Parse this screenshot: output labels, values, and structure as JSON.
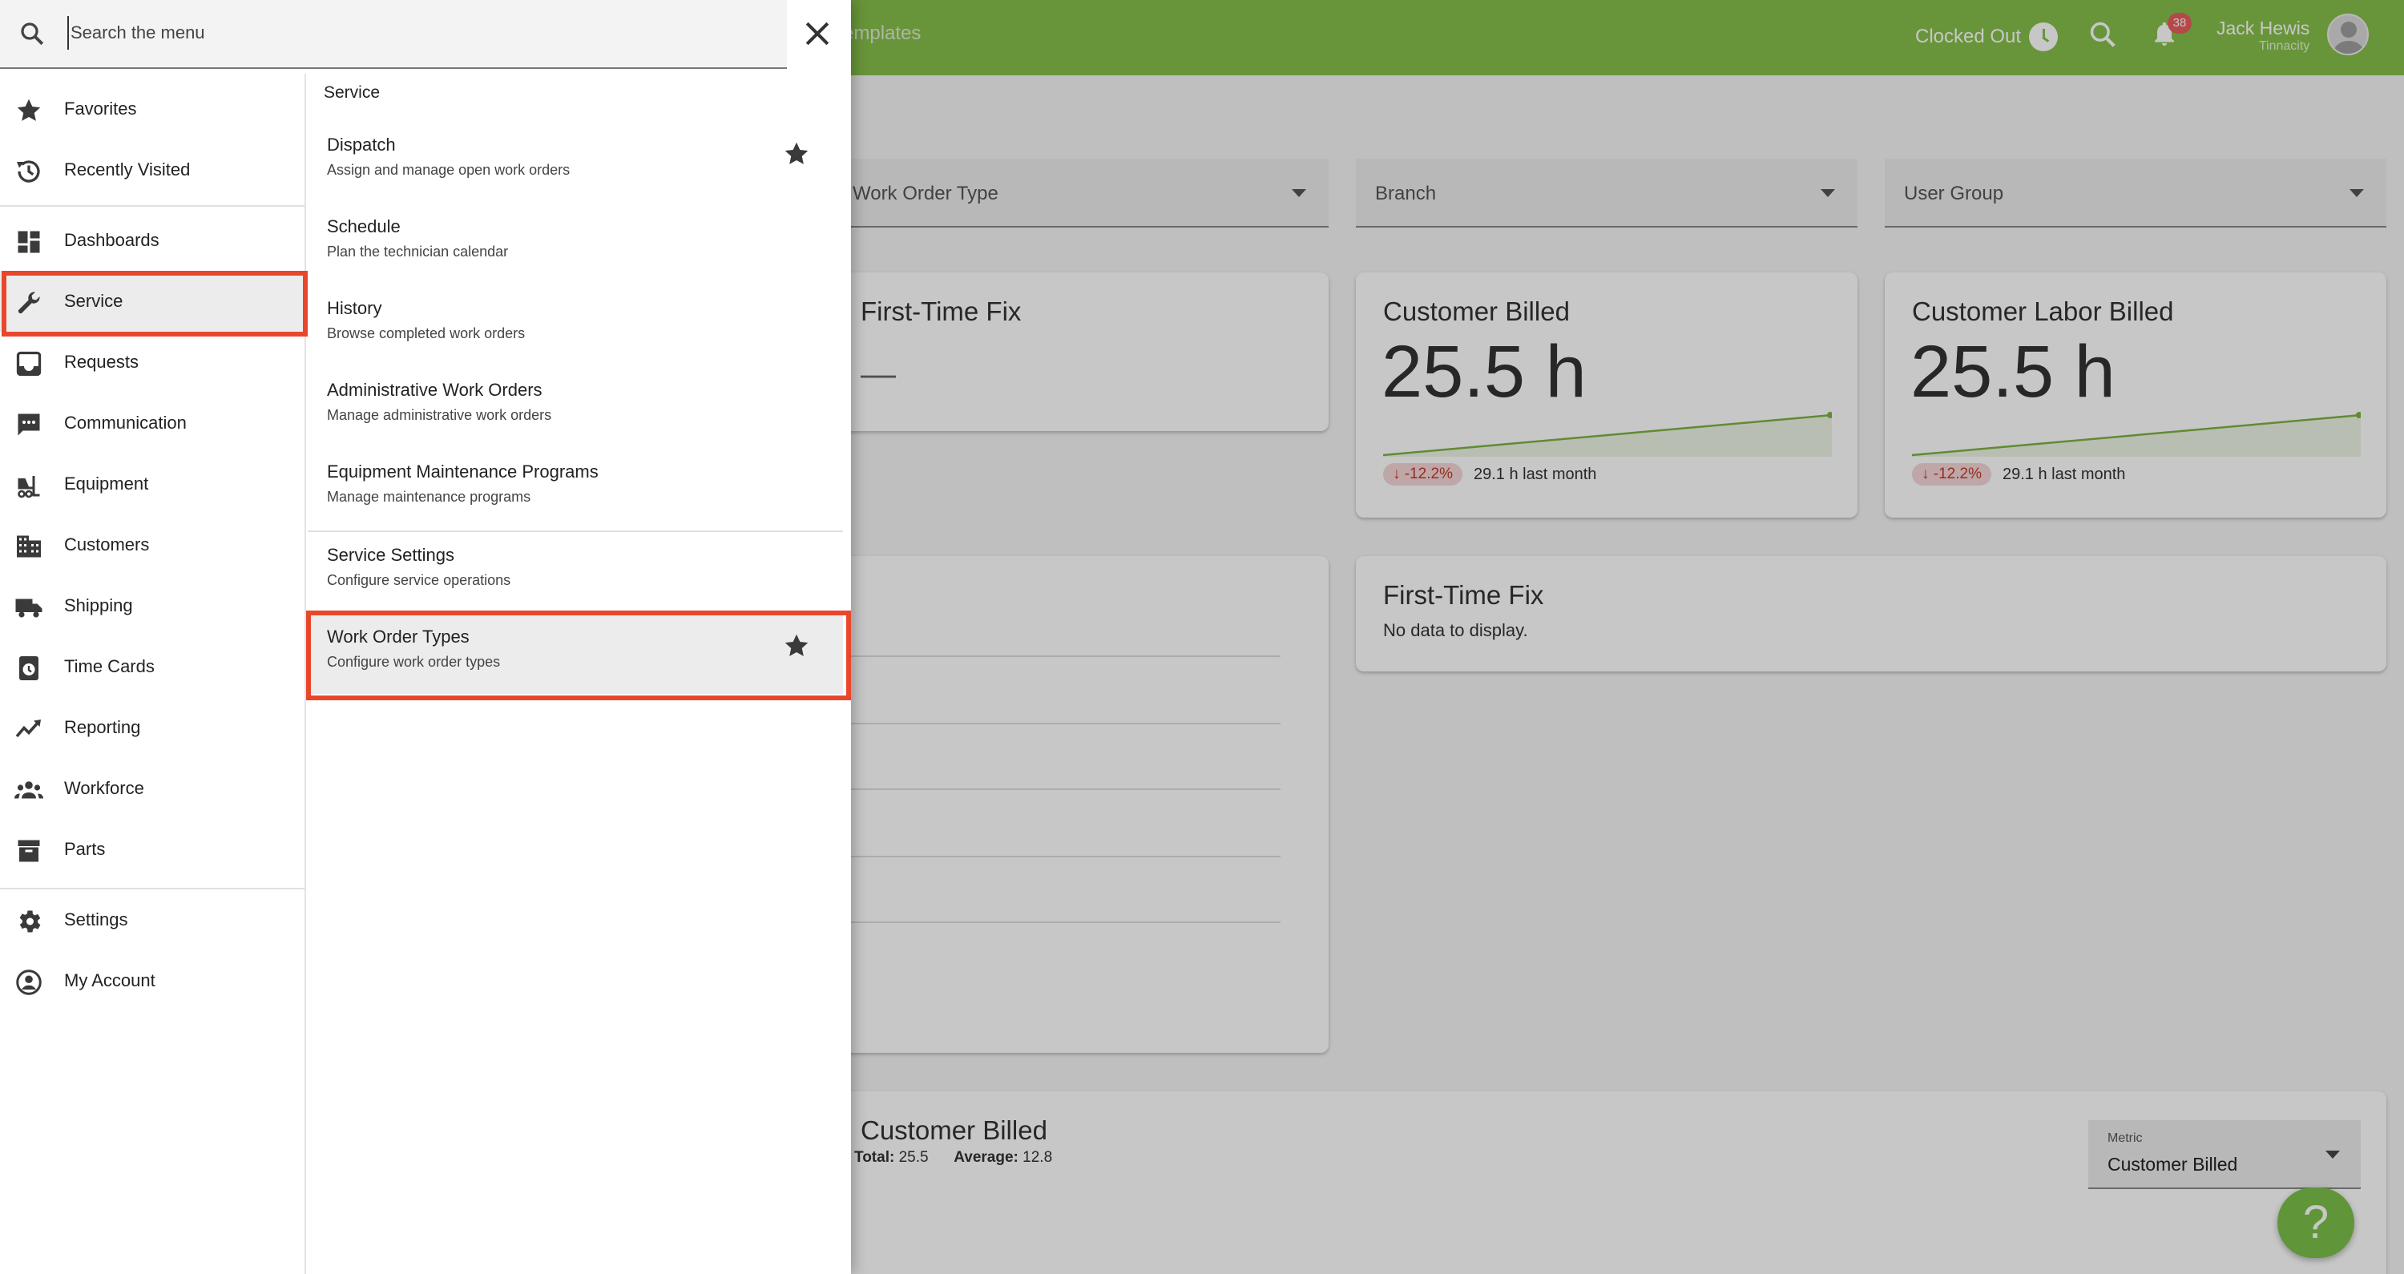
{
  "topbar": {
    "nav_link": "Templates",
    "clock_status": "Clocked Out",
    "notification_count": "38",
    "user_name": "Jack Hewis",
    "user_org": "Tinnacity"
  },
  "filters": [
    "Work Order Type",
    "Branch",
    "User Group"
  ],
  "cards": {
    "first_time_fix_title": "First-Time Fix",
    "first_time_fix_value": "—",
    "customer_billed_title": "Customer Billed",
    "customer_billed_value": "25.5 h",
    "customer_billed_delta": "-12.2%",
    "customer_billed_last": "29.1 h last month",
    "labor_billed_title": "Customer Labor Billed",
    "labor_billed_value": "25.5 h",
    "labor_billed_delta": "-12.2%",
    "labor_billed_last": "29.1 h last month",
    "ftf_chart_title": "First-Time Fix",
    "ftf_chart_nodata": "No data to display.",
    "billed_chart_title": "Customer Billed",
    "billed_total_label": "Total:",
    "billed_total_value": "25.5",
    "billed_avg_label": "Average:",
    "billed_avg_value": "12.8",
    "metric_label": "Metric",
    "metric_value": "Customer Billed"
  },
  "menu": {
    "search_placeholder": "Search the menu",
    "nav_items": [
      {
        "label": "Favorites",
        "icon": "star-icon"
      },
      {
        "label": "Recently Visited",
        "icon": "history-icon"
      },
      {
        "label": "Dashboards",
        "icon": "dashboard-icon"
      },
      {
        "label": "Service",
        "icon": "wrench-icon"
      },
      {
        "label": "Requests",
        "icon": "inbox-icon"
      },
      {
        "label": "Communication",
        "icon": "chat-icon"
      },
      {
        "label": "Equipment",
        "icon": "forklift-icon"
      },
      {
        "label": "Customers",
        "icon": "building-icon"
      },
      {
        "label": "Shipping",
        "icon": "truck-icon"
      },
      {
        "label": "Time Cards",
        "icon": "timecard-icon"
      },
      {
        "label": "Reporting",
        "icon": "trend-icon"
      },
      {
        "label": "Workforce",
        "icon": "people-icon"
      },
      {
        "label": "Parts",
        "icon": "archive-icon"
      },
      {
        "label": "Settings",
        "icon": "gear-icon"
      },
      {
        "label": "My Account",
        "icon": "account-icon"
      }
    ],
    "section_title": "Service",
    "sub_items": [
      {
        "title": "Dispatch",
        "desc": "Assign and manage open work orders"
      },
      {
        "title": "Schedule",
        "desc": "Plan the technician calendar"
      },
      {
        "title": "History",
        "desc": "Browse completed work orders"
      },
      {
        "title": "Administrative Work Orders",
        "desc": "Manage administrative work orders"
      },
      {
        "title": "Equipment Maintenance Programs",
        "desc": "Manage maintenance programs"
      },
      {
        "title": "Service Settings",
        "desc": "Configure service operations"
      },
      {
        "title": "Work Order Types",
        "desc": "Configure work order types"
      }
    ]
  },
  "colors": {
    "accent": "#86bf4b",
    "highlight": "#e8472b"
  }
}
